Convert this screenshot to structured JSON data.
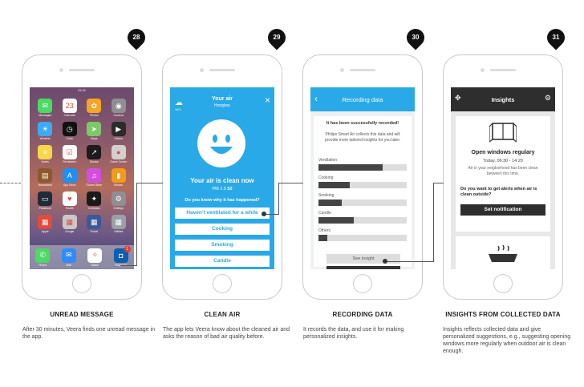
{
  "steps": [
    {
      "number": "28",
      "title": "UNREAD MESSAGE",
      "text": "After 30 minutes, Veera finds one unread message in the app."
    },
    {
      "number": "29",
      "title": "CLEAN AIR",
      "text": "The app lets Veera know about the cleaned air and asks the reason of bad air quality before."
    },
    {
      "number": "30",
      "title": "RECORDING DATA",
      "text": "It records the data, and use it for making personalized insights."
    },
    {
      "number": "31",
      "title": "INSIGHTS FROM COLLECTED DATA",
      "text": "Insights reflects collected data and give personalized suggestions, e.g., suggesting opening windows more regularly when outdoor air is clean enough."
    }
  ],
  "phone1": {
    "time": "22:41",
    "apps": [
      {
        "label": "Messages",
        "color": "#4cd964",
        "icon": "message-icon"
      },
      {
        "label": "Calendar",
        "color": "#ffffff",
        "icon": "calendar-icon"
      },
      {
        "label": "Photos",
        "color": "#f5a623",
        "icon": "photos-icon"
      },
      {
        "label": "Camera",
        "color": "#8e8e93",
        "icon": "camera-icon"
      },
      {
        "label": "Weather",
        "color": "#3ea9f5",
        "icon": "weather-icon"
      },
      {
        "label": "Clock",
        "color": "#111111",
        "icon": "clock-icon"
      },
      {
        "label": "Maps",
        "color": "#7ec86a",
        "icon": "maps-icon"
      },
      {
        "label": "Videos",
        "color": "#2b2b2b",
        "icon": "video-icon"
      },
      {
        "label": "Notes",
        "color": "#f7d64a",
        "icon": "notes-icon"
      },
      {
        "label": "Reminders",
        "color": "#ffffff",
        "icon": "reminders-icon"
      },
      {
        "label": "Stocks",
        "color": "#1c1c1c",
        "icon": "stocks-icon"
      },
      {
        "label": "Game Center",
        "color": "#d0d0d0",
        "icon": "game-center-icon"
      },
      {
        "label": "Newsstand",
        "color": "#8b5a2b",
        "icon": "newsstand-icon"
      },
      {
        "label": "App Store",
        "color": "#1f8ef1",
        "icon": "app-store-icon"
      },
      {
        "label": "iTunes Store",
        "color": "#d34de0",
        "icon": "itunes-icon"
      },
      {
        "label": "iBooks",
        "color": "#f39a1b",
        "icon": "ibooks-icon"
      },
      {
        "label": "Passbook",
        "color": "#1e2b3a",
        "icon": "passbook-icon"
      },
      {
        "label": "Health",
        "color": "#ffffff",
        "icon": "health-icon"
      },
      {
        "label": "Compass",
        "color": "#1a1a1a",
        "icon": "compass-icon"
      },
      {
        "label": "Settings",
        "color": "#8e8e93",
        "icon": "settings-icon"
      },
      {
        "label": "Apple",
        "color": "#e04b3c",
        "icon": "apple-folder-icon"
      },
      {
        "label": "Google",
        "color": "#c8c8c8",
        "icon": "google-folder-icon"
      },
      {
        "label": "Social",
        "color": "#3b5998",
        "icon": "social-folder-icon"
      },
      {
        "label": "Utilities",
        "color": "#9aa0a6",
        "icon": "utilities-folder-icon"
      }
    ],
    "dock": [
      {
        "label": "Phone",
        "color": "#4cd964",
        "icon": "phone-icon"
      },
      {
        "label": "Mail",
        "color": "#2f8cf6",
        "icon": "mail-icon"
      },
      {
        "label": "Safari",
        "color": "#ffffff",
        "icon": "safari-icon"
      },
      {
        "label": "Philips Air",
        "color": "#0b5eb0",
        "icon": "philips-air-icon"
      }
    ],
    "notification_count": "1"
  },
  "phone2": {
    "header_title": "Your air",
    "location": "Hongkou",
    "temp": "18°c",
    "status": "Your air is clean now",
    "pm_label": "PM 2.5",
    "pm_value": "52",
    "question": "Do you know why it has happened?",
    "options": [
      "Haven't ventilated for a while",
      "Cooking",
      "Smoking",
      "Candle"
    ]
  },
  "phone3": {
    "title": "Recording data",
    "success": "It has been successfully recorded!",
    "description": "Philips Smart Air collects this data and will provide more tailored insights for you later.",
    "categories": [
      {
        "label": "Ventilation",
        "value": 0.73
      },
      {
        "label": "Cooking",
        "value": 0.35
      },
      {
        "label": "Smoking",
        "value": 0.26
      },
      {
        "label": "Candle",
        "value": 0.4
      },
      {
        "label": "Others",
        "value": 0.1
      }
    ],
    "see_insight": "See insight"
  },
  "phone4": {
    "title": "Insights",
    "card_title": "Open windows regulary",
    "card_time": "Today, 06:30 - 14:20",
    "card_text": "Air in your neigborhood has been clean between this time.",
    "question": "Do you want to get alerts when air is clean outside?",
    "button": "Set notification"
  }
}
